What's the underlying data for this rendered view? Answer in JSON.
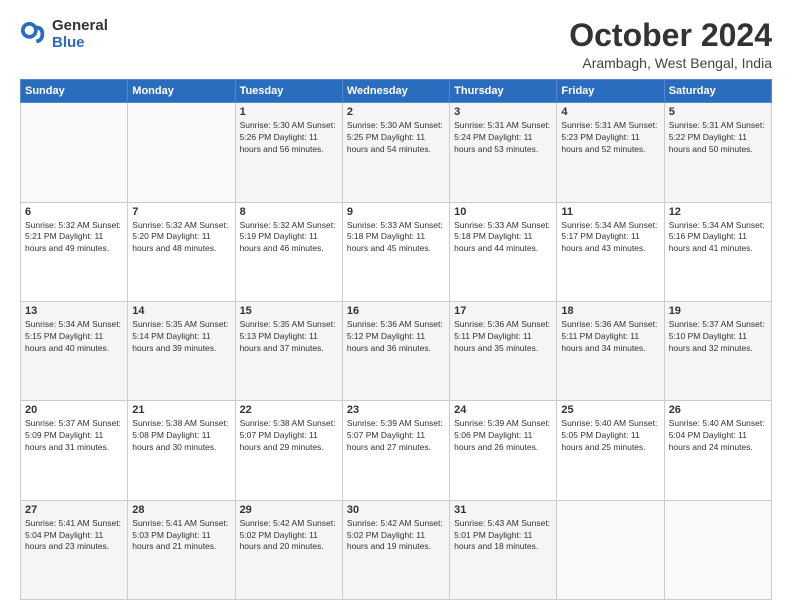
{
  "logo": {
    "general": "General",
    "blue": "Blue"
  },
  "title": "October 2024",
  "location": "Arambagh, West Bengal, India",
  "days_of_week": [
    "Sunday",
    "Monday",
    "Tuesday",
    "Wednesday",
    "Thursday",
    "Friday",
    "Saturday"
  ],
  "weeks": [
    [
      {
        "day": "",
        "info": ""
      },
      {
        "day": "",
        "info": ""
      },
      {
        "day": "1",
        "info": "Sunrise: 5:30 AM\nSunset: 5:26 PM\nDaylight: 11 hours and 56 minutes."
      },
      {
        "day": "2",
        "info": "Sunrise: 5:30 AM\nSunset: 5:25 PM\nDaylight: 11 hours and 54 minutes."
      },
      {
        "day": "3",
        "info": "Sunrise: 5:31 AM\nSunset: 5:24 PM\nDaylight: 11 hours and 53 minutes."
      },
      {
        "day": "4",
        "info": "Sunrise: 5:31 AM\nSunset: 5:23 PM\nDaylight: 11 hours and 52 minutes."
      },
      {
        "day": "5",
        "info": "Sunrise: 5:31 AM\nSunset: 5:22 PM\nDaylight: 11 hours and 50 minutes."
      }
    ],
    [
      {
        "day": "6",
        "info": "Sunrise: 5:32 AM\nSunset: 5:21 PM\nDaylight: 11 hours and 49 minutes."
      },
      {
        "day": "7",
        "info": "Sunrise: 5:32 AM\nSunset: 5:20 PM\nDaylight: 11 hours and 48 minutes."
      },
      {
        "day": "8",
        "info": "Sunrise: 5:32 AM\nSunset: 5:19 PM\nDaylight: 11 hours and 46 minutes."
      },
      {
        "day": "9",
        "info": "Sunrise: 5:33 AM\nSunset: 5:18 PM\nDaylight: 11 hours and 45 minutes."
      },
      {
        "day": "10",
        "info": "Sunrise: 5:33 AM\nSunset: 5:18 PM\nDaylight: 11 hours and 44 minutes."
      },
      {
        "day": "11",
        "info": "Sunrise: 5:34 AM\nSunset: 5:17 PM\nDaylight: 11 hours and 43 minutes."
      },
      {
        "day": "12",
        "info": "Sunrise: 5:34 AM\nSunset: 5:16 PM\nDaylight: 11 hours and 41 minutes."
      }
    ],
    [
      {
        "day": "13",
        "info": "Sunrise: 5:34 AM\nSunset: 5:15 PM\nDaylight: 11 hours and 40 minutes."
      },
      {
        "day": "14",
        "info": "Sunrise: 5:35 AM\nSunset: 5:14 PM\nDaylight: 11 hours and 39 minutes."
      },
      {
        "day": "15",
        "info": "Sunrise: 5:35 AM\nSunset: 5:13 PM\nDaylight: 11 hours and 37 minutes."
      },
      {
        "day": "16",
        "info": "Sunrise: 5:36 AM\nSunset: 5:12 PM\nDaylight: 11 hours and 36 minutes."
      },
      {
        "day": "17",
        "info": "Sunrise: 5:36 AM\nSunset: 5:11 PM\nDaylight: 11 hours and 35 minutes."
      },
      {
        "day": "18",
        "info": "Sunrise: 5:36 AM\nSunset: 5:11 PM\nDaylight: 11 hours and 34 minutes."
      },
      {
        "day": "19",
        "info": "Sunrise: 5:37 AM\nSunset: 5:10 PM\nDaylight: 11 hours and 32 minutes."
      }
    ],
    [
      {
        "day": "20",
        "info": "Sunrise: 5:37 AM\nSunset: 5:09 PM\nDaylight: 11 hours and 31 minutes."
      },
      {
        "day": "21",
        "info": "Sunrise: 5:38 AM\nSunset: 5:08 PM\nDaylight: 11 hours and 30 minutes."
      },
      {
        "day": "22",
        "info": "Sunrise: 5:38 AM\nSunset: 5:07 PM\nDaylight: 11 hours and 29 minutes."
      },
      {
        "day": "23",
        "info": "Sunrise: 5:39 AM\nSunset: 5:07 PM\nDaylight: 11 hours and 27 minutes."
      },
      {
        "day": "24",
        "info": "Sunrise: 5:39 AM\nSunset: 5:06 PM\nDaylight: 11 hours and 26 minutes."
      },
      {
        "day": "25",
        "info": "Sunrise: 5:40 AM\nSunset: 5:05 PM\nDaylight: 11 hours and 25 minutes."
      },
      {
        "day": "26",
        "info": "Sunrise: 5:40 AM\nSunset: 5:04 PM\nDaylight: 11 hours and 24 minutes."
      }
    ],
    [
      {
        "day": "27",
        "info": "Sunrise: 5:41 AM\nSunset: 5:04 PM\nDaylight: 11 hours and 23 minutes."
      },
      {
        "day": "28",
        "info": "Sunrise: 5:41 AM\nSunset: 5:03 PM\nDaylight: 11 hours and 21 minutes."
      },
      {
        "day": "29",
        "info": "Sunrise: 5:42 AM\nSunset: 5:02 PM\nDaylight: 11 hours and 20 minutes."
      },
      {
        "day": "30",
        "info": "Sunrise: 5:42 AM\nSunset: 5:02 PM\nDaylight: 11 hours and 19 minutes."
      },
      {
        "day": "31",
        "info": "Sunrise: 5:43 AM\nSunset: 5:01 PM\nDaylight: 11 hours and 18 minutes."
      },
      {
        "day": "",
        "info": ""
      },
      {
        "day": "",
        "info": ""
      }
    ]
  ]
}
